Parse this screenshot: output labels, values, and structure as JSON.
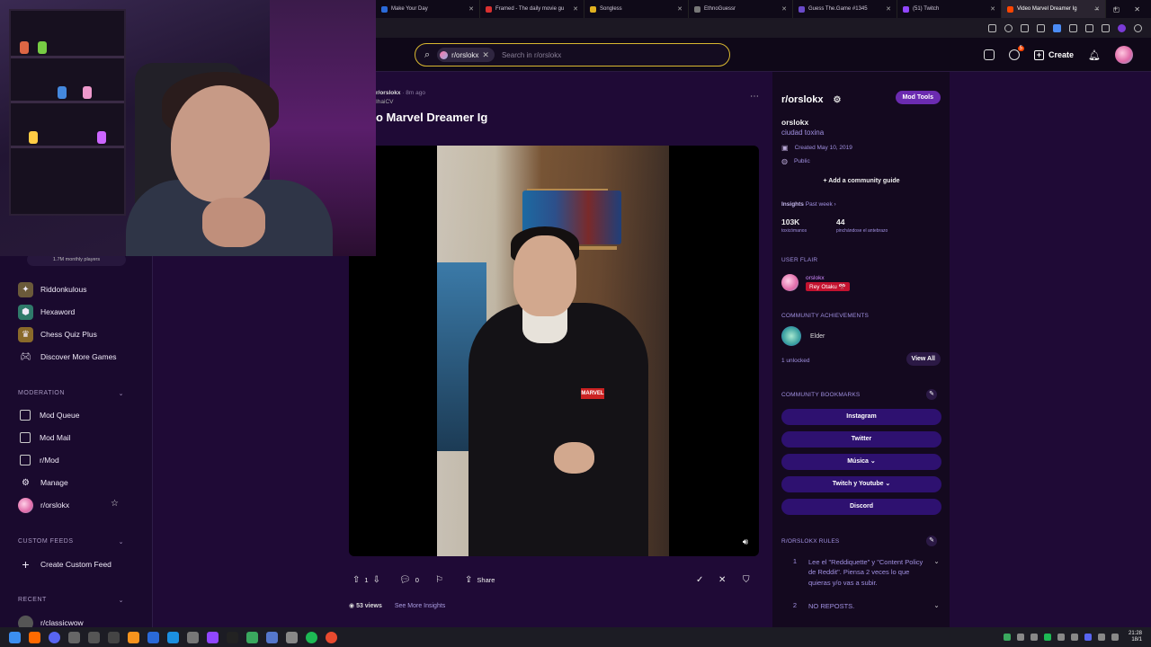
{
  "browser": {
    "tabs": [
      {
        "title": "Make Your Day",
        "color": "#2a6ad9",
        "active": false
      },
      {
        "title": "Framed - The daily movie gu",
        "color": "#d93030",
        "active": false
      },
      {
        "title": "Songless",
        "color": "#e0b020",
        "active": false
      },
      {
        "title": "EthnoGuessr",
        "color": "#777777",
        "active": false
      },
      {
        "title": "Guess The.Game #1345",
        "color": "#6a4ac9",
        "active": false
      },
      {
        "title": "(51) Twitch",
        "color": "#9146ff",
        "active": false
      },
      {
        "title": "Video Marvel Dreamer Ig",
        "color": "#ff4500",
        "active": true
      }
    ],
    "new_tab": "+",
    "window_controls": [
      "–",
      "▢",
      "✕"
    ]
  },
  "header": {
    "search_chip": "r/orslokx",
    "search_placeholder": "Search in r/orslokx",
    "create_label": "Create",
    "notification_count": "5"
  },
  "sidebar": {
    "players_pill": "1.7M monthly players",
    "games": [
      {
        "label": "Riddonkulous",
        "icon": "puzzle-icon",
        "color": "#6b5a3a"
      },
      {
        "label": "Hexaword",
        "icon": "hex-icon",
        "color": "#2f7a6a"
      },
      {
        "label": "Chess Quiz Plus",
        "icon": "chess-icon",
        "color": "#8a6a2a"
      },
      {
        "label": "Discover More Games",
        "icon": "gamepad-icon",
        "color": "transparent"
      }
    ],
    "moderation_header": "MODERATION",
    "moderation": [
      {
        "label": "Mod Queue",
        "icon": "queue-icon"
      },
      {
        "label": "Mod Mail",
        "icon": "mail-icon"
      },
      {
        "label": "r/Mod",
        "icon": "shield-icon"
      },
      {
        "label": "Manage",
        "icon": "gear-icon"
      },
      {
        "label": "r/orslokx",
        "icon": "avatar"
      }
    ],
    "custom_feeds_header": "CUSTOM FEEDS",
    "create_custom_feed": "Create Custom Feed",
    "recent_header": "RECENT",
    "recent": [
      {
        "label": "r/classicwow"
      }
    ]
  },
  "post": {
    "subreddit": "r/orslokx",
    "time": "· 8m ago",
    "author": "IhaiCV",
    "title": "o Marvel Dreamer Ig",
    "video_logo": "MARVEL",
    "upvotes": "1",
    "comments": "0",
    "share_label": "Share",
    "views_count": "53 views",
    "insights_link": "See More Insights"
  },
  "community": {
    "name": "r/orslokx",
    "mod_tools": "Mod Tools",
    "display_name": "orslokx",
    "description": "ciudad toxina",
    "created": "Created May 10, 2019",
    "visibility": "Public",
    "add_guide": "Add a community guide",
    "insights_label": "Insights",
    "insights_period": "Past week ›",
    "stats": [
      {
        "value": "103K",
        "label": "toxicómanos"
      },
      {
        "value": "44",
        "label": "pinchándose el antebrazo"
      }
    ],
    "user_flair_header": "USER FLAIR",
    "flair_user": "orslokx",
    "flair_tag": "Rey Otaku 🎌",
    "achievements_header": "COMMUNITY ACHIEVEMENTS",
    "achievement": "Elder",
    "unlocked": "1 unlocked",
    "view_all": "View All",
    "bookmarks_header": "COMMUNITY BOOKMARKS",
    "bookmarks": [
      "Instagram",
      "Twitter",
      "Música ⌄",
      "Twitch y Youtube ⌄",
      "Discord"
    ],
    "rules_header": "R/ORSLOKX RULES",
    "rules": [
      {
        "num": "1",
        "text": "Lee el \"Reddiquette\" y \"Content Policy de Reddit\". Piensa 2 veces lo que quieras y/o vas a subir."
      },
      {
        "num": "2",
        "text": "NO REPOSTS."
      }
    ]
  },
  "taskbar": {
    "time": "21:28",
    "date": "18/1"
  }
}
